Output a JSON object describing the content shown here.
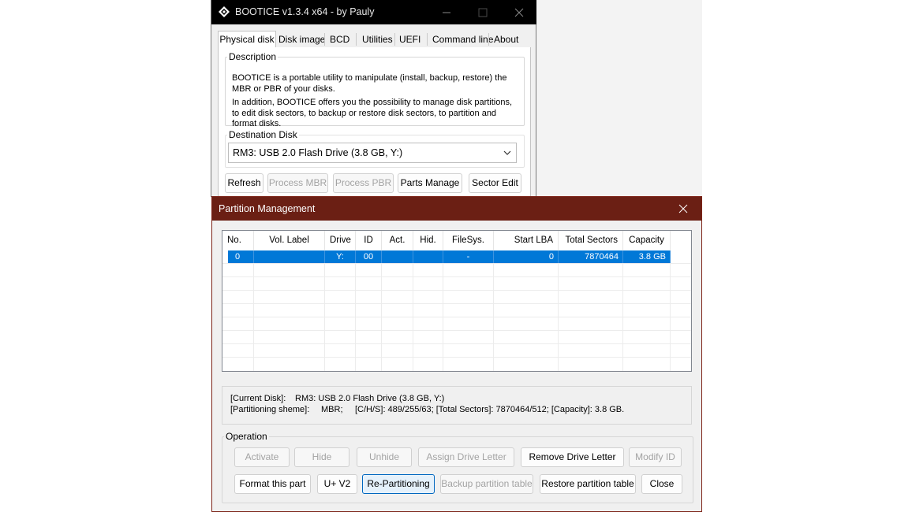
{
  "main_window": {
    "title": "BOOTICE v1.3.4 x64 - by Pauly",
    "tabs": [
      {
        "label": "Physical disk",
        "active": true
      },
      {
        "label": "Disk  image"
      },
      {
        "label": "BCD"
      },
      {
        "label": "Utilities"
      },
      {
        "label": "UEFI"
      },
      {
        "label": "Command line"
      },
      {
        "label": "About"
      }
    ],
    "description": {
      "legend": "Description",
      "para1": "BOOTICE is a portable utility to manipulate (install, backup, restore) the MBR or PBR of your disks.",
      "para2": "In addition, BOOTICE offers you the possibility to manage disk partitions, to edit disk sectors, to backup or restore disk sectors, to partition and format disks."
    },
    "destination": {
      "legend": "Destination Disk",
      "selected": "RM3: USB 2.0 Flash Drive (3.8 GB, Y:)"
    },
    "buttons": {
      "refresh": "Refresh",
      "process_mbr": "Process MBR",
      "process_pbr": "Process PBR",
      "parts_manage": "Parts Manage",
      "sector_edit": "Sector Edit"
    },
    "icons": {
      "app": "bootice-logo-icon",
      "minimize": "minimize-icon",
      "maximize": "maximize-icon",
      "close": "close-icon",
      "dropdown": "chevron-down-icon"
    }
  },
  "partition_dialog": {
    "title": "Partition Management",
    "table": {
      "headers": [
        "No.",
        "Vol. Label",
        "Drive",
        "ID",
        "Act.",
        "Hid.",
        "FileSys.",
        "Start LBA",
        "Total Sectors",
        "Capacity"
      ],
      "rows": [
        [
          "0",
          "",
          "Y:",
          "00",
          "",
          "",
          "-",
          "0",
          "7870464",
          "3.8 GB"
        ]
      ],
      "selected_row_color": "#0078d7"
    },
    "info": {
      "current_disk_label": "[Current Disk]:",
      "current_disk_value": "RM3: USB 2.0 Flash Drive (3.8 GB, Y:)",
      "scheme_label": "[Partitioning sheme]:",
      "scheme_value": "MBR;",
      "scheme_details": "[C/H/S]: 489/255/63; [Total Sectors]: 7870464/512; [Capacity]: 3.8 GB."
    },
    "operation": {
      "legend": "Operation",
      "activate": "Activate",
      "hide": "Hide",
      "unhide": "Unhide",
      "assign_letter": "Assign Drive Letter",
      "remove_letter": "Remove Drive Letter",
      "modify_id": "Modify ID",
      "format_part": "Format this part",
      "uv2": "U+ V2",
      "repartition": "Re-Partitioning",
      "backup_table": "Backup partition table",
      "restore_table": "Restore partition table",
      "close": "Close"
    },
    "accent_color": "#6b1f14"
  }
}
